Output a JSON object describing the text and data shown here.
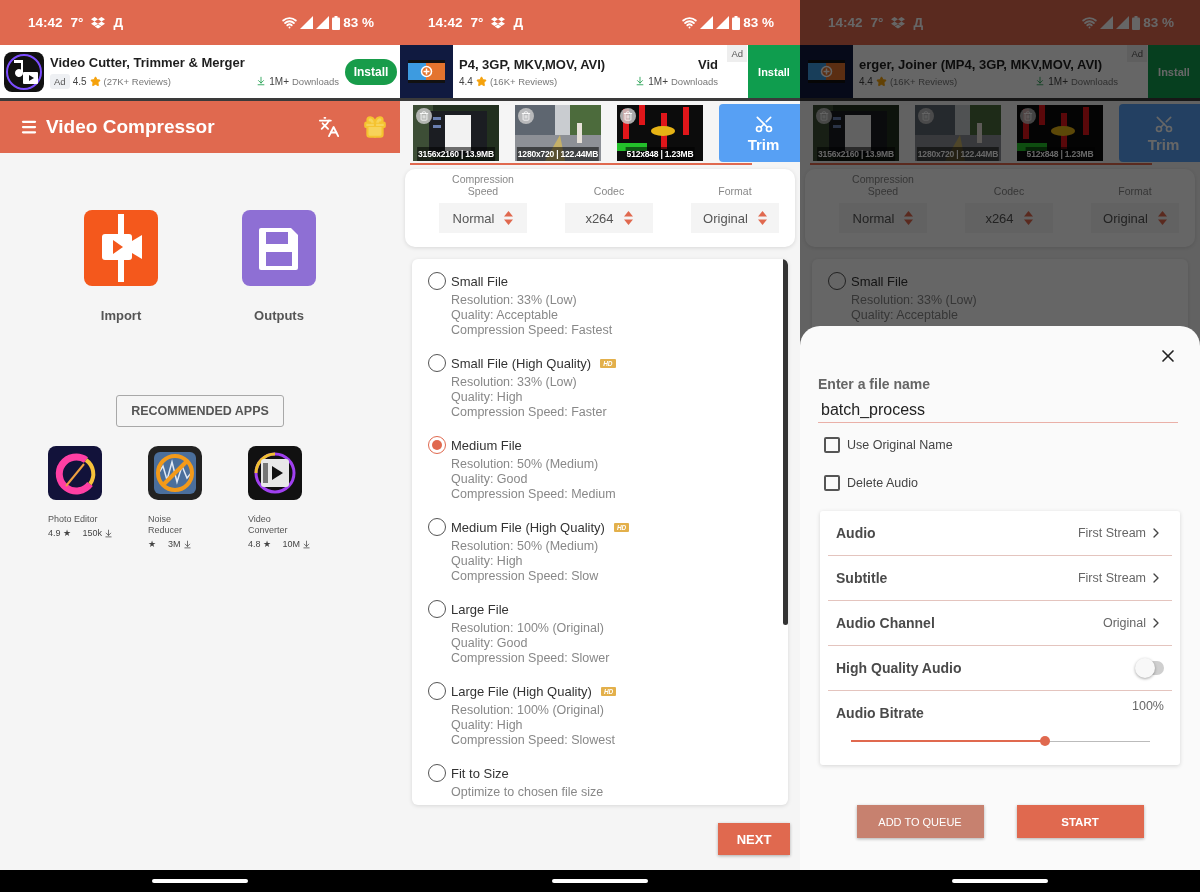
{
  "screens": [
    {
      "kind": "home",
      "status": {
        "time": "14:42",
        "temp": "7°",
        "carrier": "Д",
        "battery": "83 %"
      },
      "ad": {
        "kind": "inline",
        "title": "Video Cutter, Trimmer & Merger",
        "badge": "Ad",
        "rating": "4.5",
        "reviews": "(27K+ Reviews)",
        "downloads": "1M+",
        "downloads_label": "Downloads",
        "install": "Install"
      },
      "toolbar": {
        "title": "Video Compressor"
      },
      "actions": [
        {
          "kind": "import",
          "label": "Import"
        },
        {
          "kind": "outputs",
          "label": "Outputs"
        }
      ],
      "recommended": "RECOMMENDED APPS",
      "apps": [
        {
          "name": "Photo Editor",
          "rating": "4.9",
          "star": "★",
          "downloads": "150k"
        },
        {
          "kind": "noise",
          "name": "Noise Reducer",
          "star": "★",
          "downloads": "3M"
        },
        {
          "kind": "converter",
          "name": "Video Converter",
          "rating": "4.8",
          "star": "★",
          "downloads": "10M"
        }
      ]
    },
    {
      "kind": "compress",
      "status": {
        "time": "14:42",
        "temp": "7°",
        "carrier": "Д",
        "battery": "83 %"
      },
      "ad": {
        "kind": "banner",
        "title": "P4, 3GP, MKV,MOV, AVI)",
        "title_tail": "Vid",
        "badge": "Ad",
        "rating": "4.4",
        "reviews": "(16K+ Reviews)",
        "downloads": "1M+",
        "downloads_label": "Downloads",
        "install": "Install"
      },
      "thumbnails": [
        {
          "caption": "3156x2160 | 13.9MB"
        },
        {
          "caption": "1280x720 | 122.44MB"
        },
        {
          "caption": "512x848 | 1.23MB"
        }
      ],
      "trim": "Trim",
      "settings": [
        {
          "label": "Compression Speed",
          "value": "Normal"
        },
        {
          "label": "Codec",
          "value": "x264"
        },
        {
          "label": "Format",
          "value": "Original"
        }
      ],
      "options": [
        {
          "title": "Small File",
          "selected": false,
          "details": [
            "Resolution: 33% (Low)",
            "Quality: Acceptable",
            "Compression Speed: Fastest"
          ]
        },
        {
          "title": "Small File (High Quality)",
          "badge": "HD",
          "selected": false,
          "details": [
            "Resolution: 33% (Low)",
            "Quality: High",
            "Compression Speed: Faster"
          ]
        },
        {
          "title": "Medium File",
          "selected": true,
          "details": [
            "Resolution: 50% (Medium)",
            "Quality: Good",
            "Compression Speed: Medium"
          ]
        },
        {
          "title": "Medium File (High Quality)",
          "badge": "HD",
          "selected": false,
          "details": [
            "Resolution: 50% (Medium)",
            "Quality: High",
            "Compression Speed: Slow"
          ]
        },
        {
          "title": "Large File",
          "selected": false,
          "details": [
            "Resolution: 100% (Original)",
            "Quality: Good",
            "Compression Speed: Slower"
          ]
        },
        {
          "title": "Large File (High Quality)",
          "badge": "HD",
          "selected": false,
          "details": [
            "Resolution: 100% (Original)",
            "Quality: High",
            "Compression Speed: Slowest"
          ]
        },
        {
          "title": "Fit to Size",
          "selected": false,
          "details": [
            "Optimize to chosen file size"
          ]
        }
      ],
      "next": "NEXT"
    },
    {
      "kind": "dialog",
      "status": {
        "time": "14:42",
        "temp": "7°",
        "carrier": "Д",
        "battery": "83 %"
      },
      "ad": {
        "kind": "banner",
        "title": "erger, Joiner (MP4, 3GP, MKV,MOV, AVI)",
        "badge": "Ad",
        "rating": "4.4",
        "reviews": "(16K+ Reviews)",
        "downloads": "1M+",
        "downloads_label": "Downloads",
        "install": "Install"
      },
      "thumbnails": [
        {
          "caption": "3156x2160 | 13.9MB"
        },
        {
          "caption": "1280x720 | 122.44MB"
        },
        {
          "caption": "512x848 | 1.23MB"
        }
      ],
      "trim": "Trim",
      "settings": [
        {
          "label": "Compression Speed",
          "value": "Normal"
        },
        {
          "label": "Codec",
          "value": "x264"
        },
        {
          "label": "Format",
          "value": "Original"
        }
      ],
      "options": [
        {
          "title": "Small File",
          "selected": false,
          "details": [
            "Resolution: 33% (Low)",
            "Quality: Acceptable"
          ]
        }
      ],
      "sheet": {
        "heading": "Enter a file name",
        "file_name": "batch_process",
        "checks": [
          {
            "label": "Use Original Name",
            "checked": false
          },
          {
            "label": "Delete Audio",
            "checked": false
          }
        ],
        "rows": [
          {
            "kind": "choice",
            "label": "Audio",
            "value": "First Stream"
          },
          {
            "kind": "choice",
            "label": "Subtitle",
            "value": "First Stream"
          },
          {
            "kind": "choice",
            "label": "Audio Channel",
            "value": "Original"
          },
          {
            "kind": "toggle",
            "label": "High Quality Audio",
            "on": false
          },
          {
            "kind": "slider",
            "label": "Audio Bitrate",
            "value": "100%",
            "level": 0.65
          }
        ],
        "buttons": [
          {
            "kind": "secondary",
            "label": "ADD TO QUEUE"
          },
          {
            "kind": "primary",
            "label": "START"
          }
        ]
      }
    }
  ]
}
